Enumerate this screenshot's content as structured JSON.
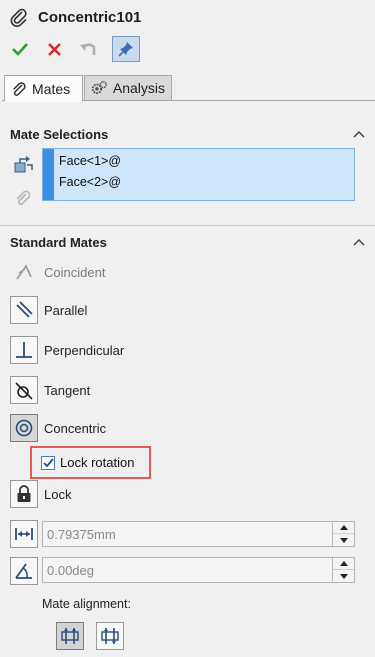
{
  "title": "Concentric101",
  "actions": {
    "ok_icon": "checkmark-icon",
    "cancel_icon": "close-icon",
    "undo_icon": "undo-icon",
    "pin_icon": "pushpin-icon"
  },
  "tabs": [
    {
      "label": "Mates",
      "icon": "paperclip-icon",
      "active": true
    },
    {
      "label": "Analysis",
      "icon": "gears-icon",
      "active": false
    }
  ],
  "mate_selections": {
    "header": "Mate Selections",
    "items": [
      "Face<1>@",
      "Face<2>@"
    ]
  },
  "standard_mates": {
    "header": "Standard Mates",
    "items": [
      {
        "label": "Coincident",
        "icon": "coincident-icon",
        "enabled": false
      },
      {
        "label": "Parallel",
        "icon": "parallel-icon",
        "enabled": true
      },
      {
        "label": "Perpendicular",
        "icon": "perpendicular-icon",
        "enabled": true
      },
      {
        "label": "Tangent",
        "icon": "tangent-icon",
        "enabled": true
      },
      {
        "label": "Concentric",
        "icon": "concentric-icon",
        "enabled": true,
        "selected": true
      }
    ],
    "lock_rotation": {
      "label": "Lock rotation",
      "checked": true
    },
    "lock": {
      "label": "Lock"
    },
    "distance": {
      "value": "0.79375mm"
    },
    "angle": {
      "value": "0.00deg"
    },
    "alignment_label": "Mate alignment:"
  },
  "colors": {
    "selection_bg": "#cfe5fa",
    "selection_bar": "#3d8ee6",
    "highlight_border": "#e15b5b",
    "ok_green": "#2e9e2e",
    "cancel_red": "#d22b2b"
  }
}
